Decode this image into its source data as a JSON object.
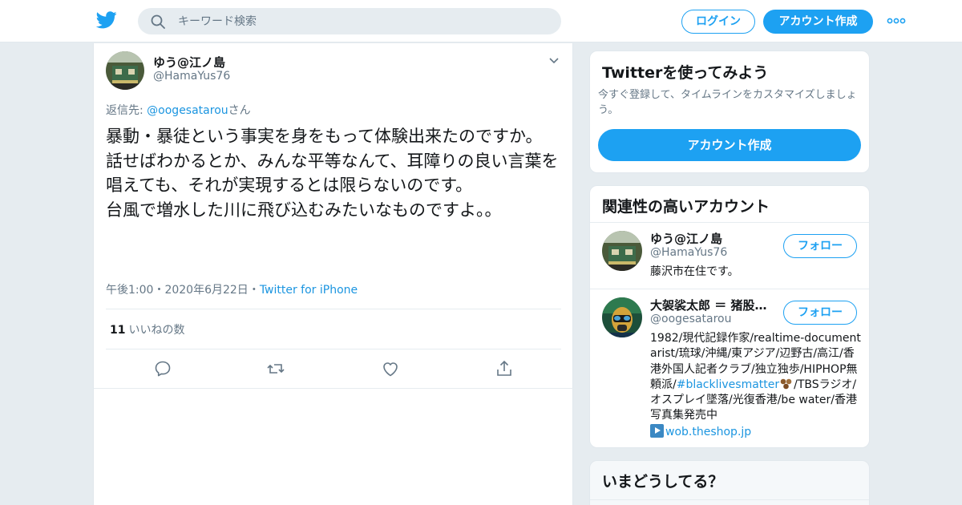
{
  "header": {
    "search_placeholder": "キーワード検索",
    "login_label": "ログイン",
    "signup_label": "アカウント作成"
  },
  "tweet": {
    "author_name": "ゆう@江ノ島",
    "author_handle": "@HamaYus76",
    "reply_prefix": "返信先: ",
    "reply_target": "@oogesatarou",
    "reply_suffix": "さん",
    "text": "暴動・暴徒という事実を身をもって体験出来たのですか。\n話せばわかるとか、みんな平等なんて、耳障りの良い言葉を唱えても、それが実現するとは限らないのです。\n台風で増水した川に飛び込むみたいなものですよ。。",
    "time": "午後1:00",
    "sep": "・",
    "date": "2020年6月22日",
    "source": "Twitter for iPhone",
    "like_count": "11",
    "like_label": "いいねの数"
  },
  "signup_card": {
    "title": "Twitterを使ってみよう",
    "description": "今すぐ登録して、タイムラインをカスタマイズしましょう。",
    "button_label": "アカウント作成"
  },
  "related": {
    "title": "関連性の高いアカウント",
    "follow_label": "フォロー",
    "accounts": [
      {
        "name": "ゆう@江ノ島",
        "handle": "@HamaYus76",
        "bio": "藤沢市在住です。"
      },
      {
        "name": "大袈裟太郎 ＝ 猪股東吾",
        "handle": "@oogesatarou",
        "bio_part1": "1982/現代記録作家/realtime-documentarist/琉球/沖縄/東アジア/辺野古/高江/香港外国人記者クラブ/独立独歩/HIPHOP無頼派/",
        "bio_hashtag": "#blacklivesmatter",
        "bio_part2": "/TBSラジオ/オスプレイ墜落/光復香港/be water/香港写真集発売中",
        "bio_link": "wob.theshop.jp"
      }
    ]
  },
  "trends_card": {
    "title": "いまどうしてる？"
  },
  "colors": {
    "accent": "#1da1f2",
    "link": "#1b95e0",
    "secondary_text": "#657786",
    "background": "#e6ecf0"
  }
}
